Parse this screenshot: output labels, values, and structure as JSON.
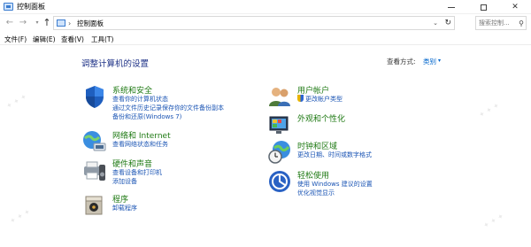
{
  "window": {
    "title": "控制面板",
    "minimize_glyph": "",
    "maximize_glyph": "",
    "close_glyph": "✕"
  },
  "navigation": {
    "back_glyph": "←",
    "forward_glyph": "→",
    "recent_glyph": "▾",
    "up_glyph": "↑",
    "address_separator": "›",
    "address_crumb": "控制面板",
    "address_dropdown_glyph": "⌄",
    "refresh_glyph": "↻",
    "search_placeholder": "搜索控制...",
    "search_icon": "magnifier-icon"
  },
  "menu": {
    "items": [
      "文件(F)",
      "编辑(E)",
      "查看(V)",
      "工具(T)"
    ]
  },
  "content": {
    "title": "调整计算机的设置",
    "view_by_label": "查看方式:",
    "view_by_value": "类别",
    "view_by_caret": "▾"
  },
  "categories": {
    "system_security": {
      "heading": "系统和安全",
      "links": [
        "查看你的计算机状态",
        "通过文件历史记录保存你的文件备份副本",
        "备份和还原(Windows 7)"
      ],
      "icon": "shield-icon"
    },
    "network": {
      "heading": "网络和 Internet",
      "links": [
        "查看网络状态和任务"
      ],
      "icon": "network-globe-icon"
    },
    "hardware": {
      "heading": "硬件和声音",
      "links": [
        "查看设备和打印机",
        "添加设备"
      ],
      "icon": "printer-speaker-icon"
    },
    "programs": {
      "heading": "程序",
      "links": [
        "卸载程序"
      ],
      "icon": "programs-box-icon"
    },
    "user_accounts": {
      "heading": "用户帐户",
      "links": [
        "更改帐户类型"
      ],
      "icon": "users-icon"
    },
    "appearance": {
      "heading": "外观和个性化",
      "links": [],
      "icon": "monitor-palette-icon"
    },
    "clock_region": {
      "heading": "时钟和区域",
      "links": [
        "更改日期、时间或数字格式"
      ],
      "icon": "clock-globe-icon"
    },
    "ease_access": {
      "heading": "轻松使用",
      "links": [
        "使用 Windows 建议的设置",
        "优化视觉显示"
      ],
      "icon": "ease-of-access-icon"
    }
  },
  "colors": {
    "heading_green": "#1f7a14",
    "link_blue": "#1a54b4",
    "title_navy": "#1e3287"
  }
}
